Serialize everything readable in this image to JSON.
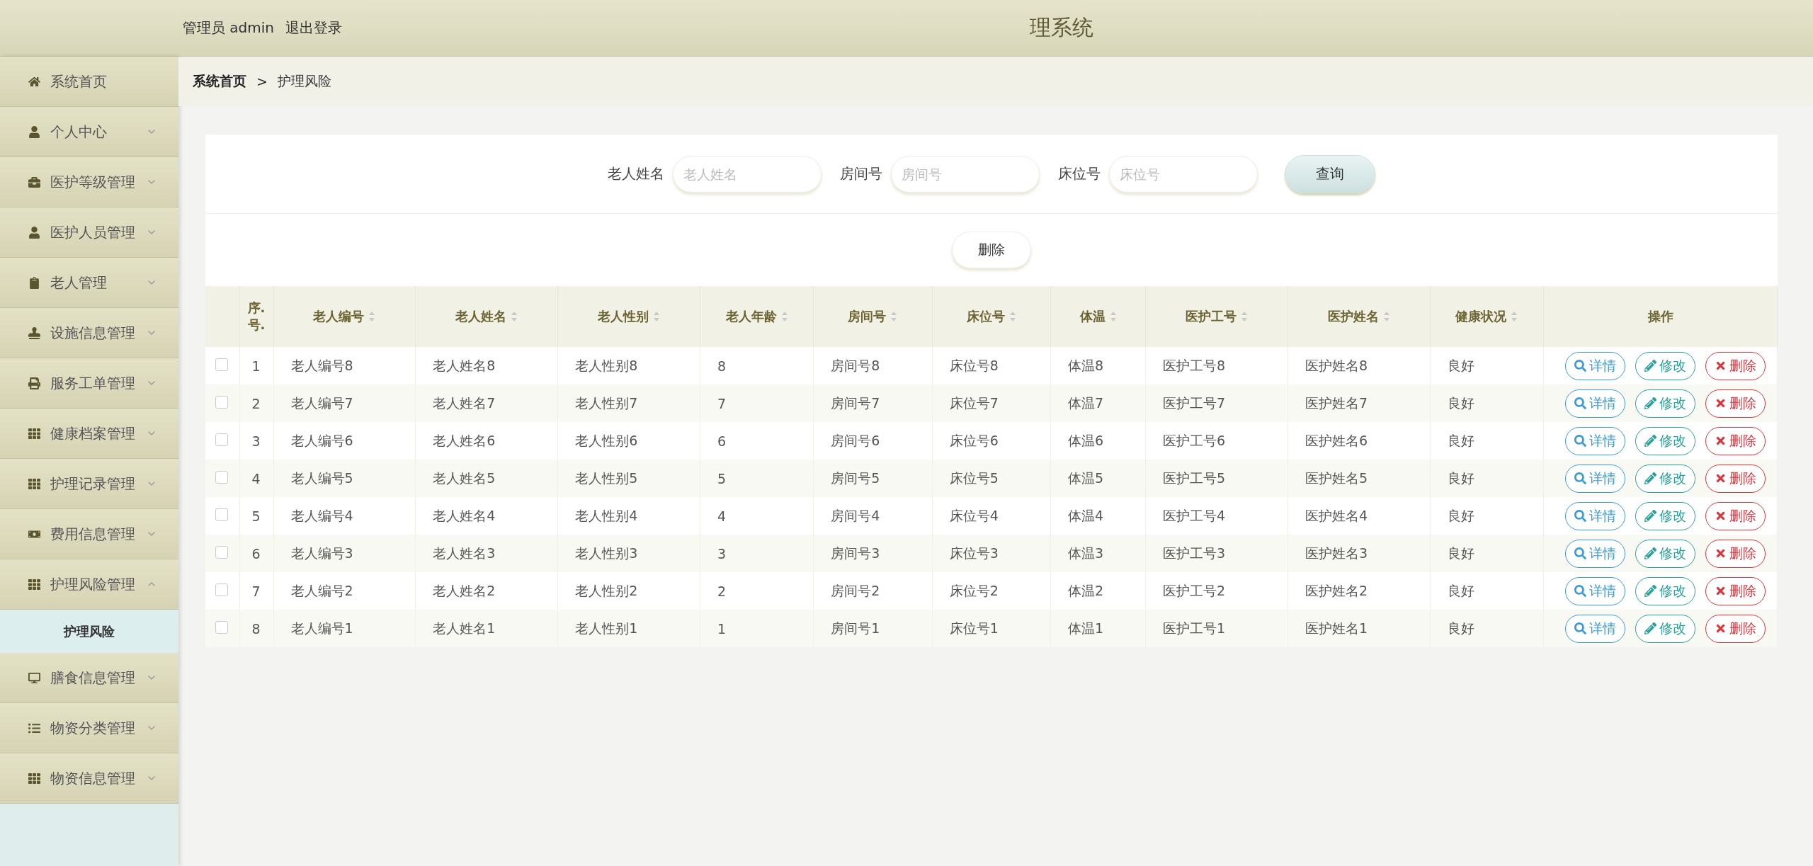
{
  "header": {
    "user": "管理员 admin",
    "logout": "退出登录",
    "title": "理系统"
  },
  "sidebar": {
    "items": [
      {
        "label": "系统首页"
      },
      {
        "label": "个人中心",
        "expanded": false
      },
      {
        "label": "医护等级管理",
        "expanded": false
      },
      {
        "label": "医护人员管理",
        "expanded": false
      },
      {
        "label": "老人管理",
        "expanded": false
      },
      {
        "label": "设施信息管理",
        "expanded": false
      },
      {
        "label": "服务工单管理",
        "expanded": false
      },
      {
        "label": "健康档案管理",
        "expanded": false
      },
      {
        "label": "护理记录管理",
        "expanded": false
      },
      {
        "label": "费用信息管理",
        "expanded": false
      },
      {
        "label": "护理风险管理",
        "expanded": true,
        "children": [
          {
            "label": "护理风险",
            "selected": true
          }
        ]
      },
      {
        "label": "膳食信息管理",
        "expanded": false
      },
      {
        "label": "物资分类管理",
        "expanded": false
      },
      {
        "label": "物资信息管理",
        "expanded": false
      }
    ]
  },
  "breadcrumb": {
    "home": "系统首页",
    "separator": ">",
    "current": "护理风险"
  },
  "search": {
    "fields": [
      {
        "label": "老人姓名",
        "placeholder": "老人姓名"
      },
      {
        "label": "房间号",
        "placeholder": "房间号"
      },
      {
        "label": "床位号",
        "placeholder": "床位号"
      }
    ],
    "button": "查询"
  },
  "delete_button": "删除",
  "table": {
    "columns": [
      {
        "label": "序.\n号.",
        "sortable": false
      },
      {
        "label": "老人编号",
        "sortable": true
      },
      {
        "label": "老人姓名",
        "sortable": true
      },
      {
        "label": "老人性别",
        "sortable": true
      },
      {
        "label": "老人年龄",
        "sortable": true
      },
      {
        "label": "房间号",
        "sortable": true
      },
      {
        "label": "床位号",
        "sortable": true
      },
      {
        "label": "体温",
        "sortable": true
      },
      {
        "label": "医护工号",
        "sortable": true
      },
      {
        "label": "医护姓名",
        "sortable": true
      },
      {
        "label": "健康状况",
        "sortable": true
      },
      {
        "label": "操作",
        "sortable": false
      }
    ],
    "rows": [
      {
        "checked": false,
        "cells": [
          "1",
          "老人编号8",
          "老人姓名8",
          "老人性别8",
          "8",
          "房间号8",
          "床位号8",
          "体温8",
          "医护工号8",
          "医护姓名8",
          "良好"
        ],
        "actions": [
          {
            "kind": "detail",
            "label": "详情"
          },
          {
            "kind": "edit",
            "label": "修改"
          },
          {
            "kind": "delete",
            "label": "删除"
          }
        ]
      },
      {
        "checked": false,
        "cells": [
          "2",
          "老人编号7",
          "老人姓名7",
          "老人性别7",
          "7",
          "房间号7",
          "床位号7",
          "体温7",
          "医护工号7",
          "医护姓名7",
          "良好"
        ],
        "actions": [
          {
            "kind": "detail",
            "label": "详情"
          },
          {
            "kind": "edit",
            "label": "修改"
          },
          {
            "kind": "delete",
            "label": "删除"
          }
        ]
      },
      {
        "checked": false,
        "cells": [
          "3",
          "老人编号6",
          "老人姓名6",
          "老人性别6",
          "6",
          "房间号6",
          "床位号6",
          "体温6",
          "医护工号6",
          "医护姓名6",
          "良好"
        ],
        "actions": [
          {
            "kind": "detail",
            "label": "详情"
          },
          {
            "kind": "edit",
            "label": "修改"
          },
          {
            "kind": "delete",
            "label": "删除"
          }
        ]
      },
      {
        "checked": false,
        "cells": [
          "4",
          "老人编号5",
          "老人姓名5",
          "老人性别5",
          "5",
          "房间号5",
          "床位号5",
          "体温5",
          "医护工号5",
          "医护姓名5",
          "良好"
        ],
        "actions": [
          {
            "kind": "detail",
            "label": "详情"
          },
          {
            "kind": "edit",
            "label": "修改"
          },
          {
            "kind": "delete",
            "label": "删除"
          }
        ]
      },
      {
        "checked": false,
        "cells": [
          "5",
          "老人编号4",
          "老人姓名4",
          "老人性别4",
          "4",
          "房间号4",
          "床位号4",
          "体温4",
          "医护工号4",
          "医护姓名4",
          "良好"
        ],
        "actions": [
          {
            "kind": "detail",
            "label": "详情"
          },
          {
            "kind": "edit",
            "label": "修改"
          },
          {
            "kind": "delete",
            "label": "删除"
          }
        ]
      },
      {
        "checked": false,
        "cells": [
          "6",
          "老人编号3",
          "老人姓名3",
          "老人性别3",
          "3",
          "房间号3",
          "床位号3",
          "体温3",
          "医护工号3",
          "医护姓名3",
          "良好"
        ],
        "actions": [
          {
            "kind": "detail",
            "label": "详情"
          },
          {
            "kind": "edit",
            "label": "修改"
          },
          {
            "kind": "delete",
            "label": "删除"
          }
        ]
      },
      {
        "checked": false,
        "cells": [
          "7",
          "老人编号2",
          "老人姓名2",
          "老人性别2",
          "2",
          "房间号2",
          "床位号2",
          "体温2",
          "医护工号2",
          "医护姓名2",
          "良好"
        ],
        "actions": [
          {
            "kind": "detail",
            "label": "详情"
          },
          {
            "kind": "edit",
            "label": "修改"
          },
          {
            "kind": "delete",
            "label": "删除"
          }
        ]
      },
      {
        "checked": false,
        "cells": [
          "8",
          "老人编号1",
          "老人姓名1",
          "老人性别1",
          "1",
          "房间号1",
          "床位号1",
          "体温1",
          "医护工号1",
          "医护姓名1",
          "良好"
        ],
        "actions": [
          {
            "kind": "detail",
            "label": "详情"
          },
          {
            "kind": "edit",
            "label": "修改"
          },
          {
            "kind": "delete",
            "label": "删除"
          }
        ]
      }
    ]
  }
}
